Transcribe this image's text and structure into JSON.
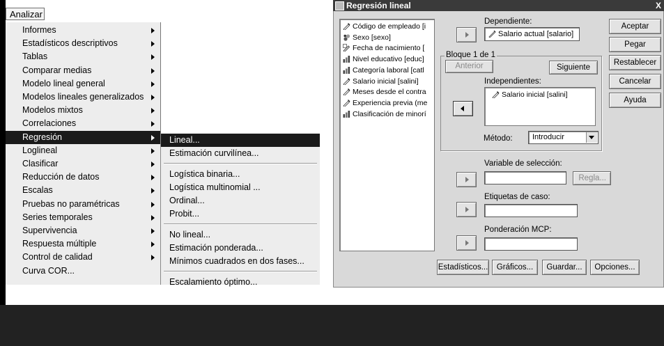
{
  "menubar": {
    "analizar": "Analizar"
  },
  "menu": {
    "items": [
      {
        "label": "Informes",
        "submenu": true
      },
      {
        "label": "Estadísticos descriptivos",
        "submenu": true
      },
      {
        "label": "Tablas",
        "submenu": true
      },
      {
        "label": "Comparar medias",
        "submenu": true
      },
      {
        "label": "Modelo lineal general",
        "submenu": true
      },
      {
        "label": "Modelos lineales generalizados",
        "submenu": true
      },
      {
        "label": "Modelos mixtos",
        "submenu": true
      },
      {
        "label": "Correlaciones",
        "submenu": true
      },
      {
        "label": "Regresión",
        "submenu": true,
        "selected": true
      },
      {
        "label": "Loglineal",
        "submenu": true
      },
      {
        "label": "Clasificar",
        "submenu": true
      },
      {
        "label": "Reducción de datos",
        "submenu": true
      },
      {
        "label": "Escalas",
        "submenu": true
      },
      {
        "label": "Pruebas no paramétricas",
        "submenu": true
      },
      {
        "label": "Series temporales",
        "submenu": true
      },
      {
        "label": "Supervivencia",
        "submenu": true
      },
      {
        "label": "Respuesta múltiple",
        "submenu": true
      },
      {
        "label": "Control de calidad",
        "submenu": true
      },
      {
        "label": "Curva COR...",
        "submenu": false
      }
    ]
  },
  "submenu": {
    "items": [
      {
        "label": "Lineal...",
        "selected": true
      },
      {
        "label": "Estimación curvilínea..."
      },
      {
        "label": "Logística binaria..."
      },
      {
        "label": "Logística multinomial ..."
      },
      {
        "label": "Ordinal..."
      },
      {
        "label": "Probit..."
      },
      {
        "label": "No lineal..."
      },
      {
        "label": "Estimación ponderada..."
      },
      {
        "label": "Mínimos cuadrados en dos fases..."
      },
      {
        "label": "Escalamiento óptimo..."
      }
    ]
  },
  "dialog": {
    "title": "Regresión lineal",
    "close": "X",
    "variables": [
      {
        "label": "Código de empleado [i",
        "icon": "scale-icon"
      },
      {
        "label": "Sexo [sexo]",
        "icon": "nominal-icon"
      },
      {
        "label": "Fecha de nacimiento [",
        "icon": "date-icon"
      },
      {
        "label": "Nivel educativo [educ]",
        "icon": "ordinal-icon"
      },
      {
        "label": "Categoría laboral [catl",
        "icon": "ordinal-icon"
      },
      {
        "label": "Salario inicial [salini]",
        "icon": "scale-icon"
      },
      {
        "label": "Meses desde el contra",
        "icon": "scale-icon"
      },
      {
        "label": "Experiencia previa (me",
        "icon": "scale-icon"
      },
      {
        "label": "Clasificación de minorí",
        "icon": "ordinal-icon"
      }
    ],
    "dependiente_label": "Dependiente:",
    "dependiente_value": "Salario actual [salario]",
    "bloque_label": "Bloque 1 de 1",
    "anterior": "Anterior",
    "siguiente": "Siguiente",
    "independientes_label": "Independientes:",
    "independientes": [
      "Salario inicial [salini]"
    ],
    "metodo_label": "Método:",
    "metodo_value": "Introducir",
    "seleccion_label": "Variable de selección:",
    "regla": "Regla...",
    "etiquetas_label": "Etiquetas de caso:",
    "ponderacion_label": "Ponderación MCP:",
    "buttons": {
      "aceptar": "Aceptar",
      "pegar": "Pegar",
      "restablecer": "Restablecer",
      "cancelar": "Cancelar",
      "ayuda": "Ayuda"
    },
    "bottom_buttons": {
      "estadisticos": "Estadísticos...",
      "graficos": "Gráficos...",
      "guardar": "Guardar...",
      "opciones": "Opciones..."
    }
  }
}
